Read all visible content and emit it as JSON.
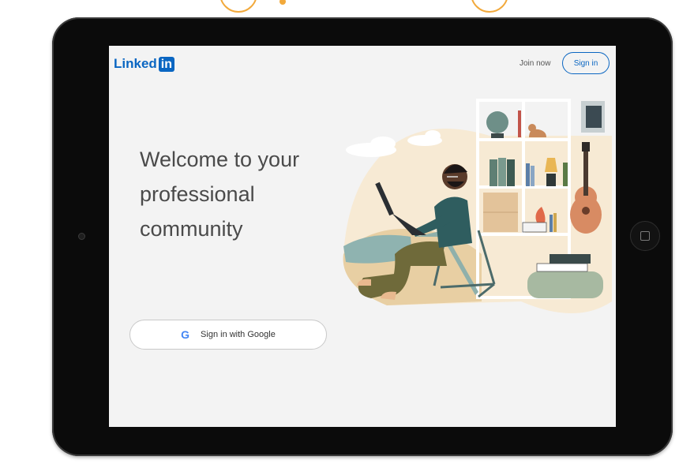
{
  "header": {
    "logo_text": "Linked",
    "logo_box": "in",
    "join_label": "Join now",
    "signin_label": "Sign in"
  },
  "hero": {
    "headline": "Welcome to your professional community"
  },
  "google": {
    "icon_letter": "G",
    "label": "Sign in with Google"
  },
  "colors": {
    "brand": "#0a66c2",
    "screen_bg": "#f3f3f3",
    "accent_orange": "#f2a93b"
  },
  "icons": [
    "google-icon",
    "linkedin-logo",
    "home-button-icon"
  ]
}
